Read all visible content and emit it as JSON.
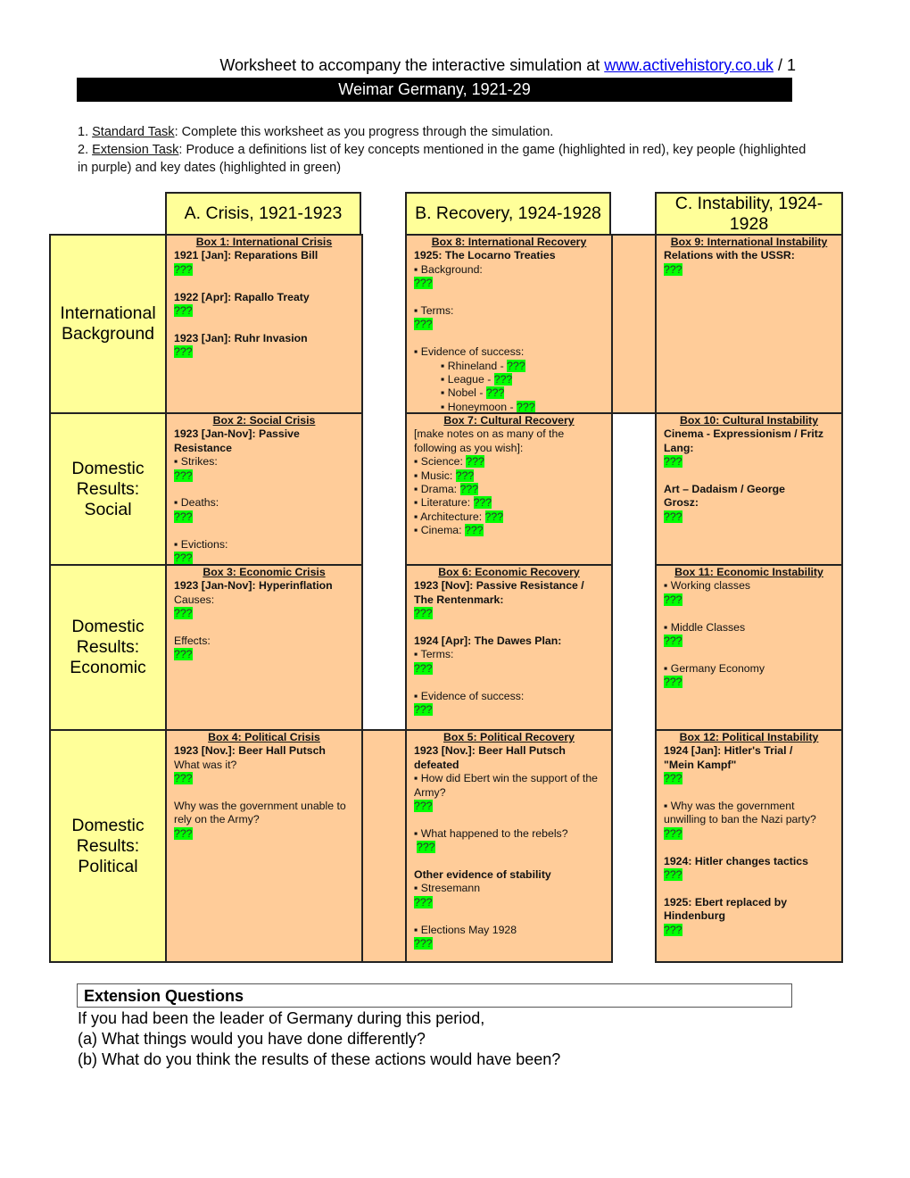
{
  "header": {
    "prefix": "Worksheet to accompany the interactive simulation at ",
    "link_text": "www.activehistory.co.uk",
    "suffix": " / 1",
    "title": "Weimar Germany, 1921-29"
  },
  "tasks": [
    {
      "num": "1. ",
      "label": "Standard Task",
      "text": ": Complete this worksheet as you progress through the simulation."
    },
    {
      "num": "2. ",
      "label": "Extension Task",
      "text": ": Produce a definitions list of key concepts mentioned in the game (highlighted in red), key people (highlighted in purple) and key dates (highlighted in green)"
    }
  ],
  "columns": [
    "A. Crisis, 1921-1923",
    "B. Recovery, 1924-1928",
    "C. Instability, 1924-1928"
  ],
  "rows": [
    "International Background",
    "Domestic Results: Social",
    "Domestic Results: Economic",
    "Domestic Results: Political"
  ],
  "placeholder": "???",
  "colors": {
    "header_yellow": "#ffff99",
    "cell_orange": "#ffcc99",
    "answer_green": "#00ff00",
    "title_bar": "#000000",
    "link": "#0000ee"
  },
  "boxes": {
    "box1": {
      "title": "Box 1: International Crisis",
      "h1": "1921 [Jan]: Reparations Bill",
      "h2": "1922 [Apr]: Rapallo Treaty",
      "h3": "1923 [Jan]: Ruhr Invasion"
    },
    "box8": {
      "title": "Box 8: International Recovery",
      "h1": "1925: The Locarno Treaties",
      "l1": "▪ Background:",
      "l2": "▪ Terms:",
      "l3": "▪ Evidence of success:",
      "s1": "▪ Rhineland - ",
      "s2": "▪ League - ",
      "s3": "▪ Nobel - ",
      "s4": "▪ Honeymoon - "
    },
    "box9": {
      "title": "Box 9: International Instability",
      "h1": "Relations with the USSR:"
    },
    "box2": {
      "title": "Box 2: Social Crisis",
      "h1": "1923 [Jan-Nov]: Passive Resistance",
      "l1": "▪ Strikes:",
      "l2": "▪ Deaths:",
      "l3": "▪ Evictions:"
    },
    "box7": {
      "title": "Box 7: Cultural Recovery",
      "intro": "[make notes on as many of the following as you wish]:",
      "l1": "▪ Science: ",
      "l2": "▪ Music: ",
      "l3": "▪ Drama: ",
      "l4": "▪ Literature: ",
      "l5": "▪ Architecture: ",
      "l6": "▪ Cinema: "
    },
    "box10": {
      "title": "Box 10: Cultural Instability",
      "h1": "Cinema - Expressionism / Fritz Lang:",
      "h2": "Art – Dadaism / George Grosz:"
    },
    "box3": {
      "title": "Box 3: Economic Crisis",
      "h1": "1923 [Jan-Nov]: Hyperinflation",
      "l1": "Causes:",
      "l2": "Effects:"
    },
    "box6": {
      "title": "Box 6: Economic Recovery",
      "h1": "1923 [Nov]: Passive Resistance / The Rentenmark:",
      "h2": "1924 [Apr]: The Dawes Plan:",
      "l1": "▪ Terms:",
      "l2": "▪ Evidence of success:"
    },
    "box11": {
      "title": "Box 11: Economic Instability",
      "l1": "▪ Working classes",
      "l2": "▪ Middle Classes",
      "l3": "▪ Germany Economy"
    },
    "box4": {
      "title": "Box 4: Political Crisis",
      "h1": "1923 [Nov.]: Beer Hall Putsch",
      "l1": "What was it?",
      "l2": "Why was the government unable to rely on the Army?"
    },
    "box5": {
      "title": "Box 5: Political Recovery",
      "h1": "1923 [Nov.]: Beer Hall Putsch defeated",
      "l1": "▪ How did Ebert win the support of the Army?",
      "l2": "▪ What happened to the rebels?",
      "h2": "Other evidence of stability",
      "l3": "▪ Stresemann",
      "l4": "▪ Elections May 1928"
    },
    "box12": {
      "title": "Box 12: Political Instability",
      "h1": "1924 [Jan]: Hitler's Trial / \"Mein Kampf\"",
      "l1": "▪ Why was the government unwilling to ban the Nazi party?",
      "h2": "1924: Hitler changes tactics",
      "h3": "1925: Ebert replaced by Hindenburg"
    }
  },
  "extension": {
    "heading": "Extension Questions",
    "lines": [
      "If you had been the leader of Germany during this period,",
      "(a) What things would you have done differently?",
      "(b) What do you think the results of these actions would have been?"
    ]
  }
}
